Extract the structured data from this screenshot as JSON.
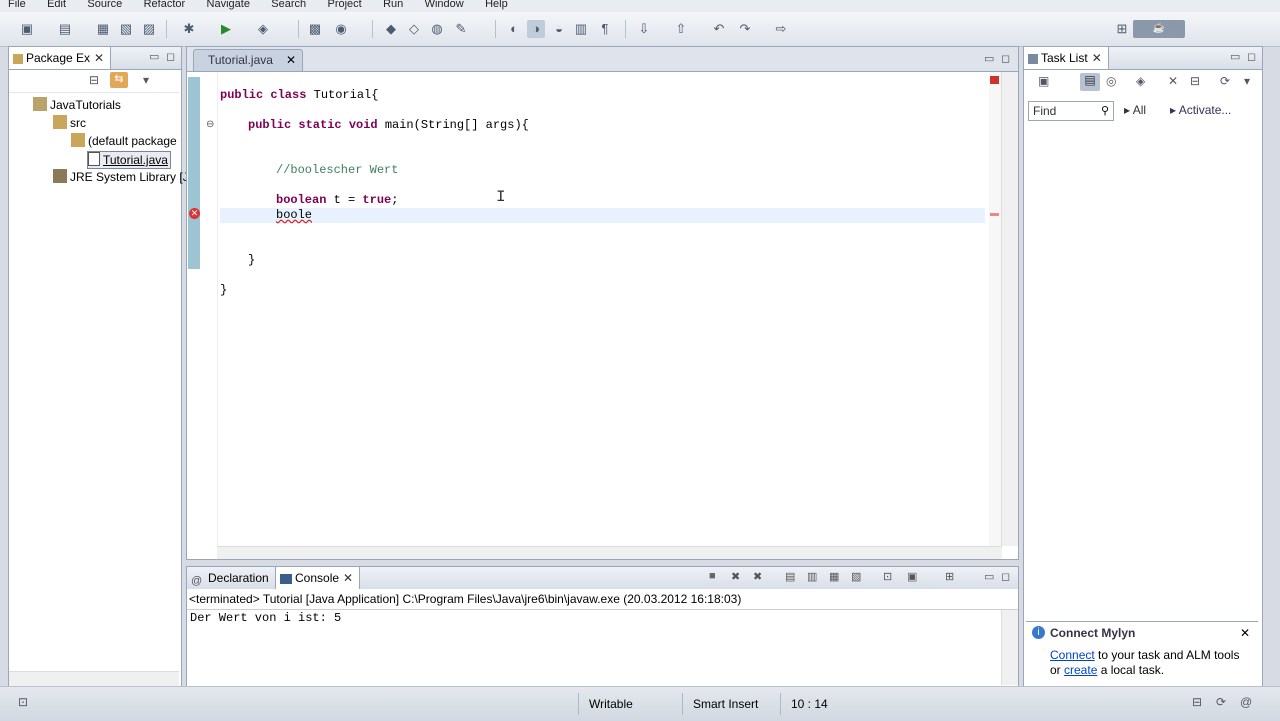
{
  "menu": [
    "File",
    "Edit",
    "Source",
    "Refactor",
    "Navigate",
    "Search",
    "Project",
    "Run",
    "Window",
    "Help"
  ],
  "package_explorer": {
    "title": "Package Ex",
    "items": [
      "JavaTutorials",
      "src",
      "(default package",
      "Tutorial.java",
      "JRE System Library [J"
    ]
  },
  "editor": {
    "tab_title": "Tutorial.java",
    "lines": [
      {
        "kw": "public class ",
        "rest": "Tutorial{"
      },
      {
        "kw": "public static void ",
        "rest": "main(String[] args){"
      },
      {
        "comment": "//boolescher Wert"
      },
      {
        "kw": "boolean ",
        "rest": "t = ",
        "kw2": "true",
        ";": ";"
      },
      {
        "rest": "boole"
      },
      {
        "rest": "}"
      },
      {
        "rest": "}"
      }
    ]
  },
  "console_view": {
    "tab_declaration": "Declaration",
    "tab_console": "Console",
    "header": "<terminated> Tutorial [Java Application] C:\\Program Files\\Java\\jre6\\bin\\javaw.exe (20.03.2012 16:18:03)",
    "output": "Der Wert von i ist: 5"
  },
  "task_list": {
    "title": "Task List",
    "find_placeholder": "Find",
    "all_label": "All",
    "activate_label": "Activate..."
  },
  "mylyn": {
    "title": "Connect Mylyn",
    "connect_link": "Connect",
    "text1": " to your task and ALM tools",
    "text2_prefix": "or ",
    "create_link": "create",
    "text2_suffix": " a local task."
  },
  "status_bar": {
    "writable": "Writable",
    "insert_mode": "Smart Insert",
    "position": "10 : 14"
  },
  "colors": {
    "keyword": "#7f0055",
    "comment": "#3f7f5f",
    "link": "#0044cc"
  }
}
